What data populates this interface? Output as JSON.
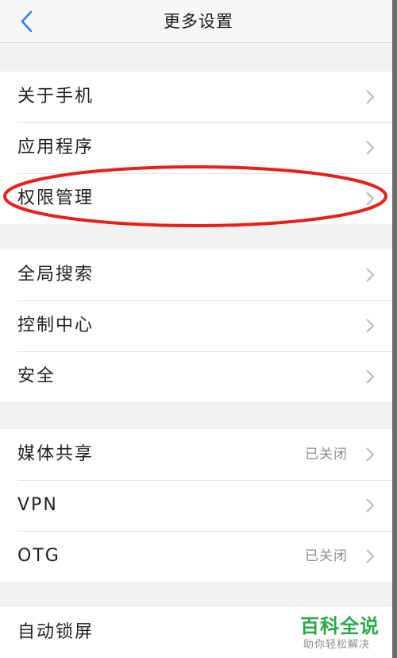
{
  "header": {
    "title": "更多设置",
    "back_icon": "chevron-left-icon",
    "accent": "#2f7df6"
  },
  "groups": [
    [
      {
        "label": "关于手机",
        "value": ""
      },
      {
        "label": "应用程序",
        "value": ""
      },
      {
        "label": "权限管理",
        "value": ""
      }
    ],
    [
      {
        "label": "全局搜索",
        "value": ""
      },
      {
        "label": "控制中心",
        "value": ""
      },
      {
        "label": "安全",
        "value": ""
      }
    ],
    [
      {
        "label": "媒体共享",
        "value": "已关闭"
      },
      {
        "label": "VPN",
        "value": ""
      },
      {
        "label": "OTG",
        "value": "已关闭"
      }
    ],
    [
      {
        "label": "自动锁屏",
        "value": ""
      }
    ]
  ],
  "annotation": {
    "highlight_color": "#e8201a"
  },
  "watermark": {
    "title": "百科全说",
    "subtitle": "助你轻松解决",
    "color": "#2aa84a"
  }
}
